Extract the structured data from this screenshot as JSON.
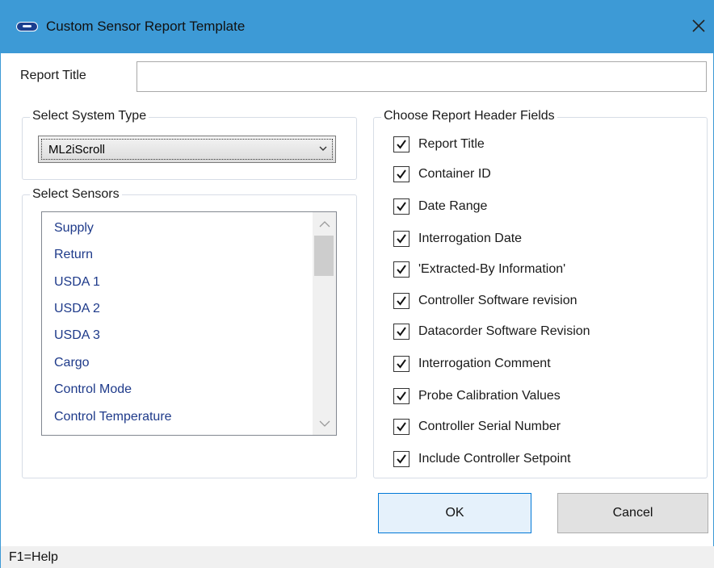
{
  "window": {
    "title": "Custom Sensor Report Template",
    "icon": "carrier-logo-icon",
    "close_glyph": "close-icon"
  },
  "report_title": {
    "label": "Report Title",
    "value": "",
    "placeholder": ""
  },
  "system_type": {
    "legend": "Select System Type",
    "selected": "ML2iScroll"
  },
  "sensors": {
    "legend": "Select Sensors",
    "items": [
      "Supply",
      "Return",
      "USDA 1",
      "USDA 2",
      "USDA 3",
      "Cargo",
      "Control Mode",
      "Control Temperature"
    ]
  },
  "header_fields": {
    "legend": "Choose Report Header Fields",
    "items": [
      {
        "label": "Report Title",
        "checked": true
      },
      {
        "label": "Container ID",
        "checked": true
      },
      {
        "label": "Date Range",
        "checked": true
      },
      {
        "label": "Interrogation Date",
        "checked": true
      },
      {
        "label": "'Extracted-By Information'",
        "checked": true
      },
      {
        "label": "Controller Software revision",
        "checked": true
      },
      {
        "label": "Datacorder Software Revision",
        "checked": true
      },
      {
        "label": "Interrogation Comment",
        "checked": true
      },
      {
        "label": "Probe Calibration Values",
        "checked": true
      },
      {
        "label": "Controller Serial Number",
        "checked": true
      },
      {
        "label": "Include Controller Setpoint",
        "checked": true
      }
    ]
  },
  "buttons": {
    "ok": "OK",
    "cancel": "Cancel"
  },
  "statusbar": {
    "text": "F1=Help"
  },
  "colors": {
    "titlebar": "#3d9ad6",
    "list_text": "#1e3a8a",
    "ok_border": "#0078d7"
  }
}
